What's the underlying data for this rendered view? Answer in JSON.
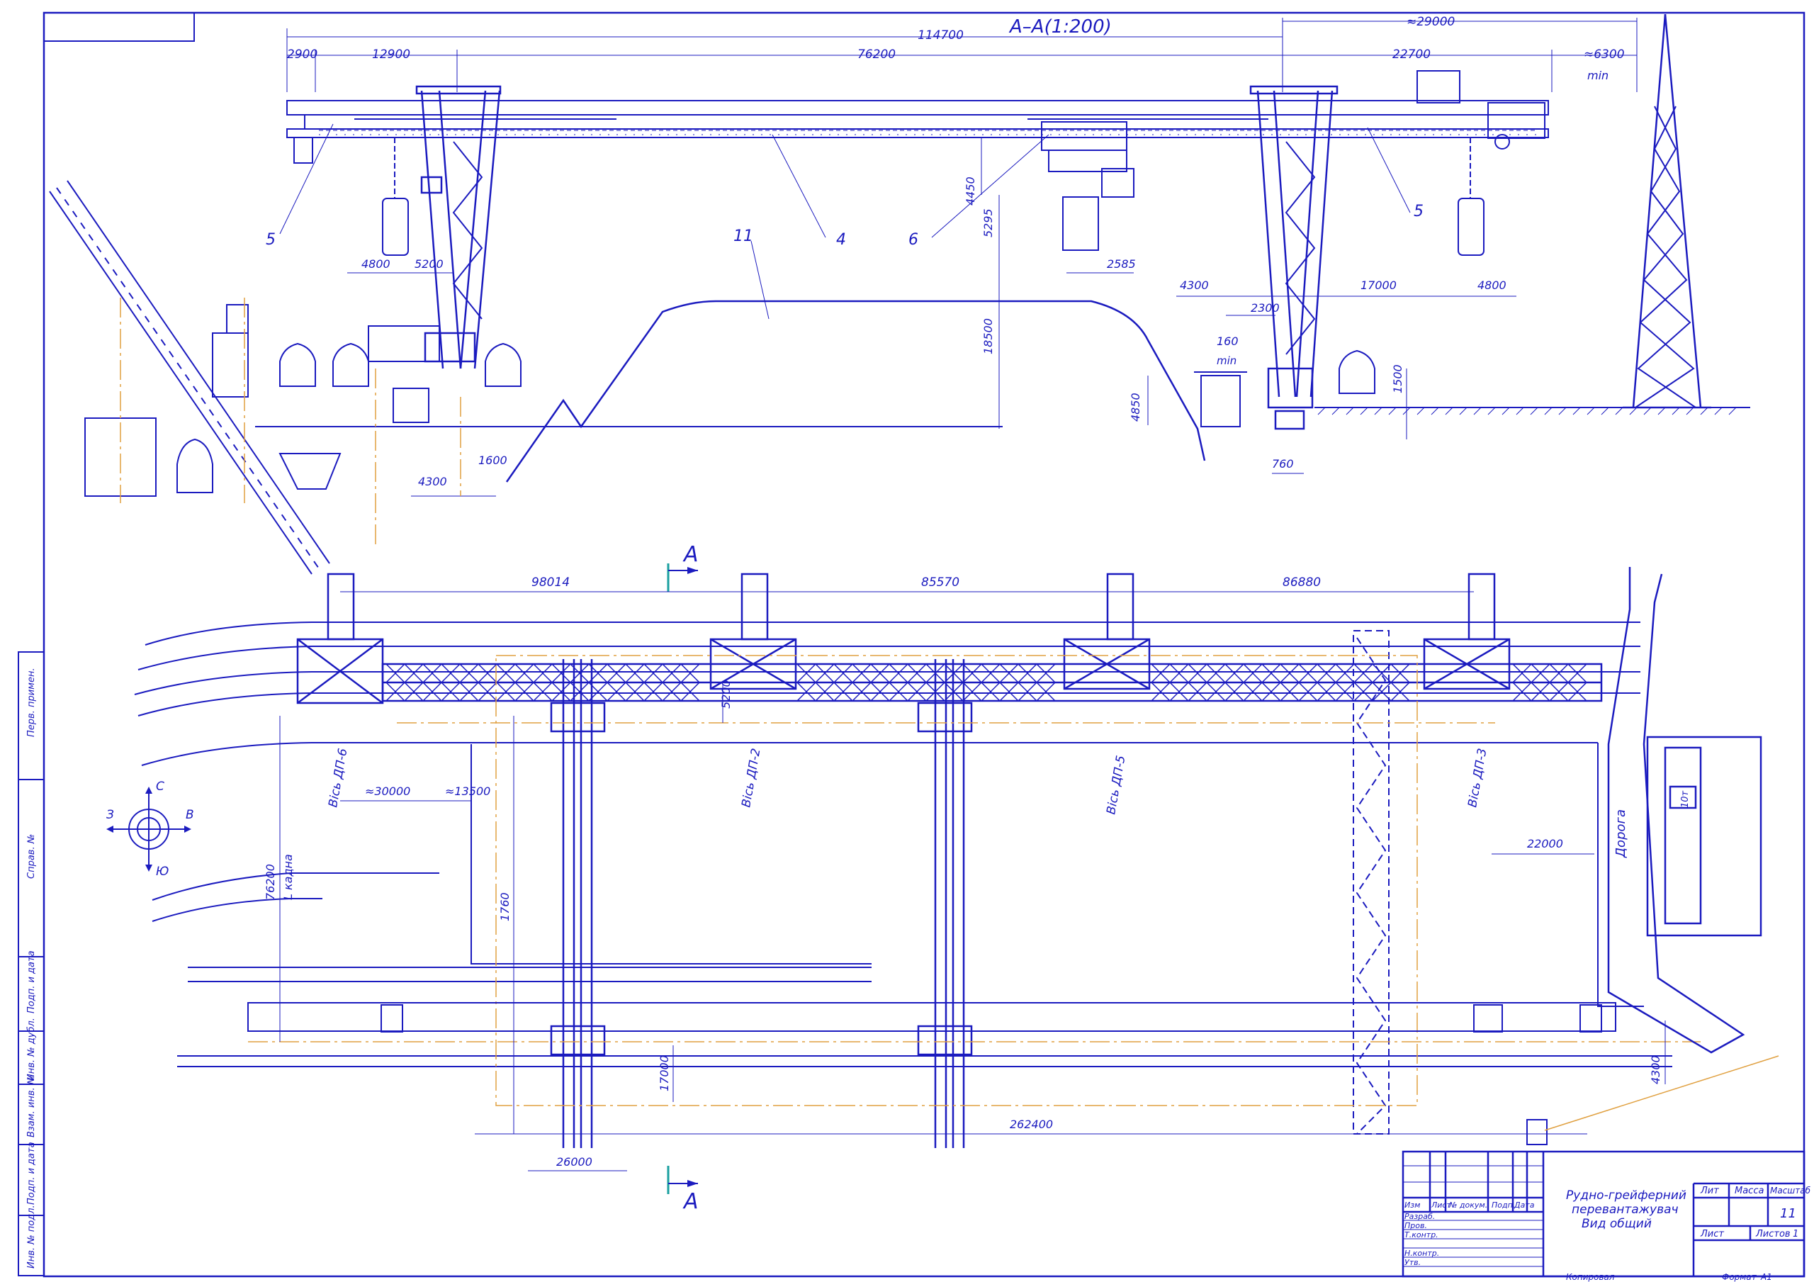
{
  "section_title": "А–А(1:200)",
  "dims_top": {
    "total_length": "114700",
    "left_end": "2900",
    "left_cantilever": "12900",
    "span": "76200",
    "right_total": "≈29000",
    "right_cantilever": "22700",
    "tower_offset": "≈6300",
    "tower_offset_note": "min",
    "d_4800_left": "4800",
    "d_5200": "5200",
    "d_4450": "4450",
    "d_5295": "5295",
    "d_2585": "2585",
    "d_18500": "18500",
    "d_4300_right": "4300",
    "d_17000": "17000",
    "d_4800_right": "4800",
    "d_2300": "2300",
    "d_160": "160",
    "d_160_note": "min",
    "d_4850": "4850",
    "d_1500": "1500",
    "d_760": "760",
    "d_4300_left": "4300",
    "d_1600": "1600"
  },
  "callouts": [
    "5",
    "4",
    "6",
    "11",
    "5"
  ],
  "dims_plan": {
    "d_98014": "98014",
    "d_85570": "85570",
    "d_86880": "86880",
    "d_30000": "≈30000",
    "d_13500": "≈13500",
    "d_76200": "76200",
    "l_track": "L кадна",
    "d_1760": "1760",
    "d_5200": "5200",
    "d_22000": "22000",
    "d_17000": "17000",
    "d_26000": "26000",
    "d_262400": "262400",
    "d_4300": "4300"
  },
  "axes": [
    "Вісь ДП-6",
    "Вісь ДП-2",
    "Вісь ДП-5",
    "Вісь ДП-3"
  ],
  "road": "Дорога",
  "section_mark": "А",
  "compass": {
    "n": "С",
    "s": "Ю",
    "w": "З",
    "e": "В"
  },
  "weight_tag": "10т",
  "side_stamp": [
    "Перв. примен.",
    "Справ. №",
    "Подп. и дата",
    "Инв. № дубл.",
    "Взам. инв. №",
    "Подп. и дата",
    "Инв. № подл."
  ],
  "title_block": {
    "title_line1": "Рудно-грейферний",
    "title_line2": "перевантажувач",
    "title_line3": "Вид общий",
    "hdr_izm": "Изм",
    "hdr_list": "Лист",
    "hdr_doc": "№ докум.",
    "hdr_sign": "Подп.",
    "hdr_date": "Дата",
    "r_razrab": "Разраб.",
    "r_prov": "Пров.",
    "r_tkontr": "Т.контр.",
    "r_nkontr": "Н.контр.",
    "r_utv": "Утв.",
    "col_lit": "Лит",
    "col_mass": "Масса",
    "col_scale": "Масштаб",
    "scale_value": "11",
    "sheet_label": "Лист",
    "sheets_label": "Листов",
    "sheets_value": "1",
    "copied": "Копировал",
    "format_label": "Формат",
    "format_value": "А1"
  }
}
